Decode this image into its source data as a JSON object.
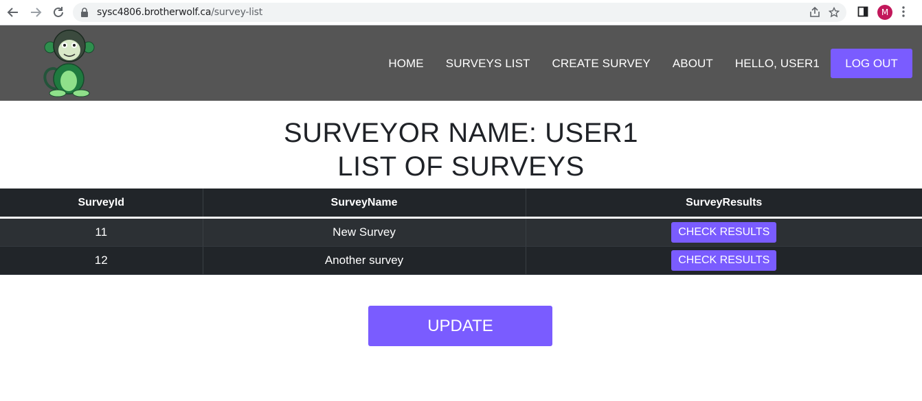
{
  "browser": {
    "url_host": "sysc4806.brotherwolf.ca",
    "url_path": "/survey-list",
    "profile_initial": "M",
    "icons": [
      "back-arrow-icon",
      "forward-arrow-icon",
      "reload-icon",
      "lock-icon",
      "share-icon",
      "star-icon",
      "side-panel-icon",
      "more-menu-icon"
    ]
  },
  "header": {
    "logo_icon": "monkey-logo",
    "nav": {
      "home": "HOME",
      "surveys_list": "SURVEYS LIST",
      "create_survey": "CREATE SURVEY",
      "about": "ABOUT",
      "greeting": "HELLO, USER1",
      "logout": "LOG OUT"
    }
  },
  "main": {
    "title_line1": "SURVEYOR NAME: USER1",
    "title_line2": "LIST OF SURVEYS",
    "table": {
      "headers": [
        "SurveyId",
        "SurveyName",
        "SurveyResults"
      ],
      "rows": [
        {
          "id": "11",
          "name": "New Survey",
          "action": "CHECK RESULTS"
        },
        {
          "id": "12",
          "name": "Another survey",
          "action": "CHECK RESULTS"
        }
      ]
    },
    "update_label": "UPDATE"
  },
  "colors": {
    "accent": "#7a5cff",
    "header_bg": "#555555",
    "table_dark": "#212529",
    "table_stripe": "#2c3034"
  }
}
